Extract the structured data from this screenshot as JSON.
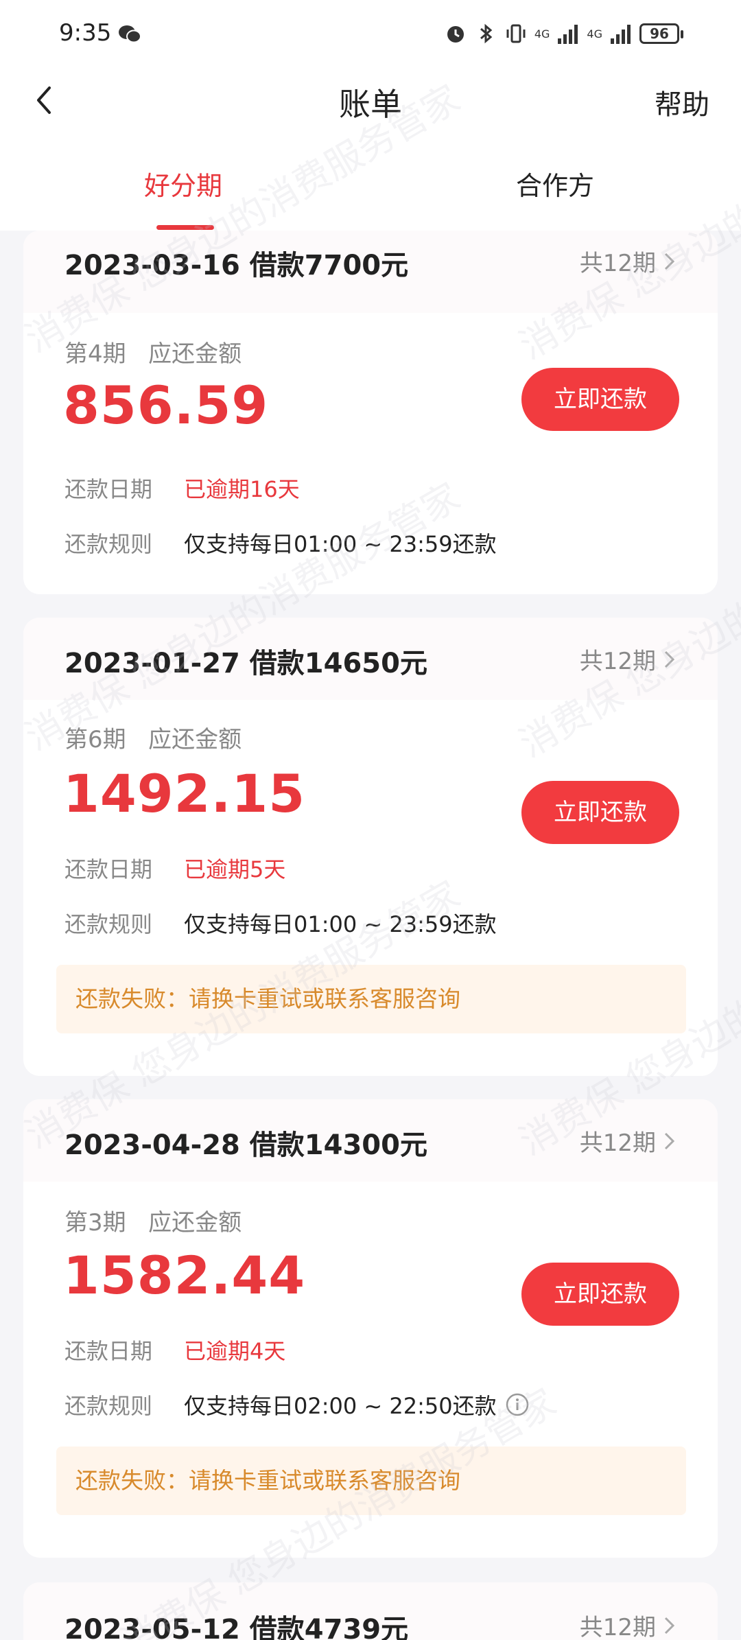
{
  "status_bar": {
    "time": "9:35",
    "network1": "4G",
    "network2": "4G",
    "battery": "96"
  },
  "nav": {
    "title": "账单",
    "help": "帮助"
  },
  "tabs": [
    {
      "label": "好分期",
      "active": true
    },
    {
      "label": "合作方",
      "active": false
    }
  ],
  "labels": {
    "due_amount": "应还金额",
    "repay_now": "立即还款",
    "repay_date": "还款日期",
    "repay_rule": "还款规则"
  },
  "bills": [
    {
      "date_loan": "2023-03-16 借款7700元",
      "total_periods": "共12期",
      "period": "第4期",
      "amount": "856.59",
      "overdue": "已逾期16天",
      "rule": "仅支持每日01:00 ~ 23:59还款",
      "failure": ""
    },
    {
      "date_loan": "2023-01-27 借款14650元",
      "total_periods": "共12期",
      "period": "第6期",
      "amount": "1492.15",
      "overdue": "已逾期5天",
      "rule": "仅支持每日01:00 ~ 23:59还款",
      "failure": "还款失败：请换卡重试或联系客服咨询"
    },
    {
      "date_loan": "2023-04-28 借款14300元",
      "total_periods": "共12期",
      "period": "第3期",
      "amount": "1582.44",
      "overdue": "已逾期4天",
      "rule": "仅支持每日02:00 ~ 22:50还款",
      "failure": "还款失败：请换卡重试或联系客服咨询"
    },
    {
      "date_loan": "2023-05-12 借款4739元",
      "total_periods": "共12期"
    }
  ],
  "watermark": "消费保 您身边的消费服务管家",
  "colors": {
    "accent": "#e8383d",
    "button": "#f23b3f",
    "warning_text": "#d88a2c",
    "warning_bg": "#fff5eb"
  }
}
